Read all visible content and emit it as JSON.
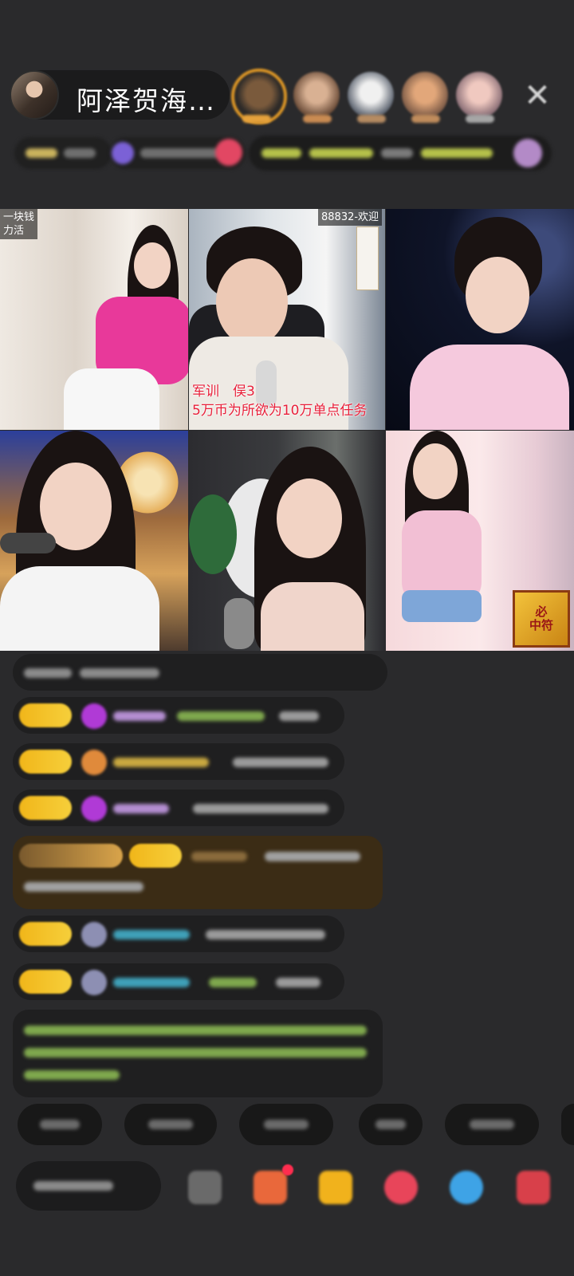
{
  "header": {
    "host_name": "阿泽贺海…",
    "close_icon": "close-icon"
  },
  "video_grid": {
    "tile1_tag": "一块钱\n力活",
    "tile2_tag": "88832-欢迎",
    "tile2_caption_line1": "军训　俣3",
    "tile2_caption_line2": "5万币为所欲为10万单点任务",
    "tile6_badge_line1": "必",
    "tile6_badge_line2": "中符"
  },
  "colors": {
    "background": "#2a2a2c",
    "gold_badge": "#f1b61a",
    "chat_bubble": "#1f1f20",
    "accent_red": "#e8203a"
  }
}
